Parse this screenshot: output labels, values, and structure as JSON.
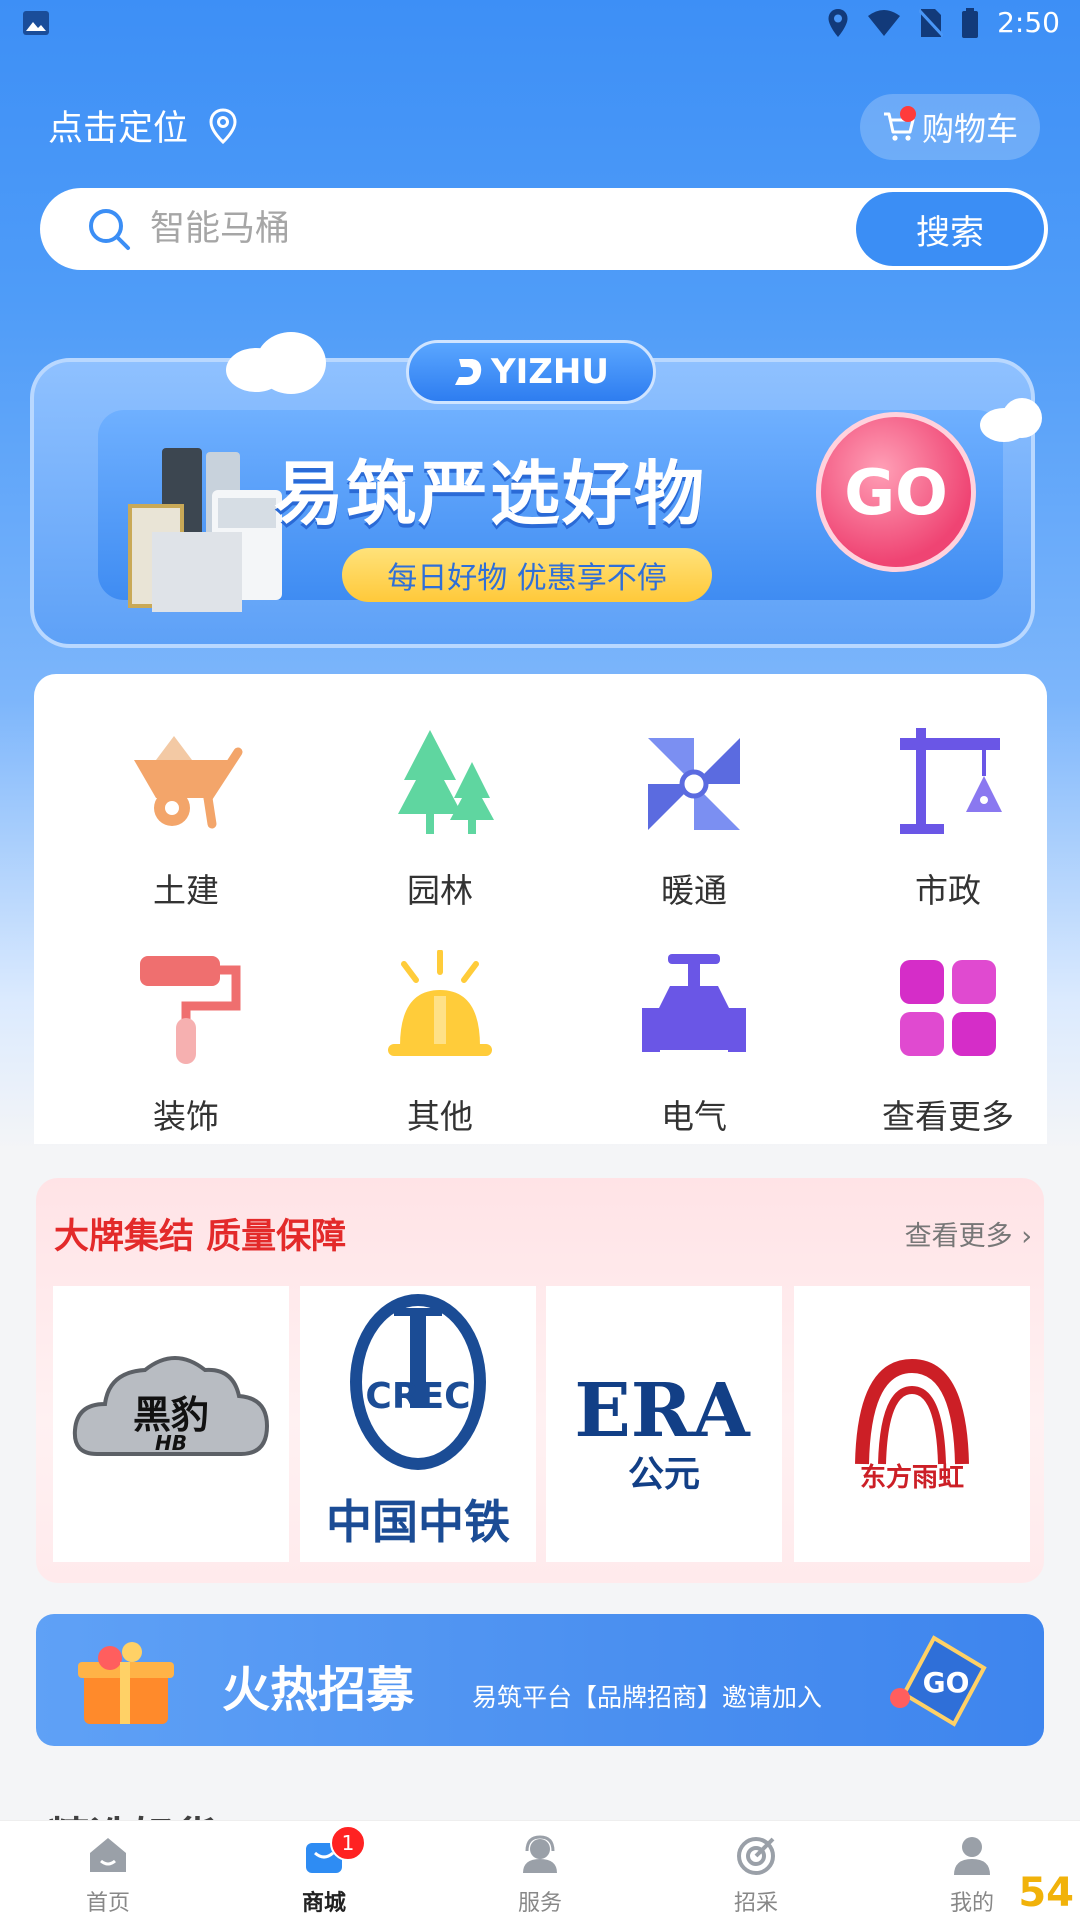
{
  "status_bar": {
    "time": "2:50"
  },
  "header": {
    "location_label": "点击定位",
    "cart_label": "购物车"
  },
  "search": {
    "placeholder": "智能马桶",
    "button_label": "搜索"
  },
  "banner": {
    "brand": "YIZHU",
    "headline": "易筑严选好物",
    "subline": "每日好物 优惠享不停",
    "go_label": "GO"
  },
  "categories": [
    {
      "label": "土建",
      "icon": "wheelbarrow-icon"
    },
    {
      "label": "园林",
      "icon": "trees-icon"
    },
    {
      "label": "暖通",
      "icon": "fan-icon"
    },
    {
      "label": "市政",
      "icon": "crane-icon"
    },
    {
      "label": "装饰",
      "icon": "paint-roller-icon"
    },
    {
      "label": "其他",
      "icon": "helmet-icon"
    },
    {
      "label": "电气",
      "icon": "valve-icon"
    },
    {
      "label": "查看更多",
      "icon": "grid-icon"
    }
  ],
  "brands_section": {
    "title": "大牌集结 质量保障",
    "more_label": "查看更多",
    "brands": [
      {
        "name": "黑豹",
        "sub": "HB"
      },
      {
        "name": "中国中铁",
        "logo_text": "CREC"
      },
      {
        "name": "ERA",
        "sub": "公元"
      },
      {
        "name": "东方雨虹"
      }
    ]
  },
  "recruit": {
    "title": "火热招募",
    "subtitle": "易筑平台【品牌招商】邀请加入",
    "go_label": "GO"
  },
  "next_section_title": "精选好货",
  "tabbar": {
    "items": [
      {
        "label": "首页",
        "icon": "home-icon"
      },
      {
        "label": "商城",
        "icon": "shop-bag-icon",
        "badge": "1"
      },
      {
        "label": "服务",
        "icon": "service-headset-icon"
      },
      {
        "label": "招采",
        "icon": "target-icon"
      },
      {
        "label": "我的",
        "icon": "user-icon"
      }
    ],
    "active_index": 1
  },
  "watermark": "54"
}
